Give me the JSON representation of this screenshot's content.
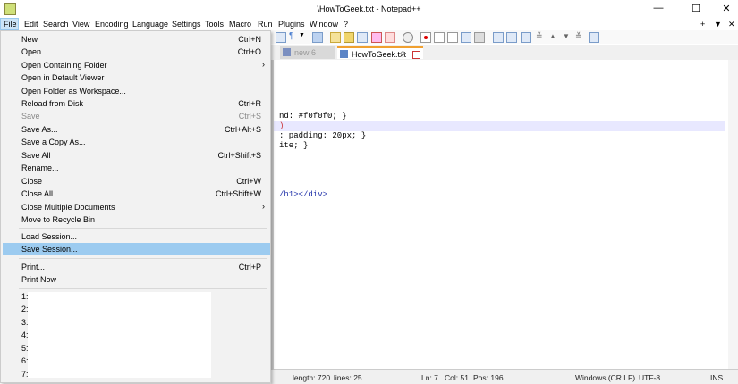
{
  "window": {
    "title": "\\HowToGeek.txt - Notepad++",
    "controls": [
      "—",
      "☐",
      "✕"
    ]
  },
  "menubar": [
    "File",
    "Edit",
    "Search",
    "View",
    "Encoding",
    "Language",
    "Settings",
    "Tools",
    "Macro",
    "Run",
    "Plugins",
    "Window",
    "?"
  ],
  "menubar_right": [
    "+",
    "▼",
    "✕"
  ],
  "tabs": [
    {
      "label": "new 6",
      "active": false
    },
    {
      "label": "HowToGeek.txt",
      "active": true
    }
  ],
  "editor": {
    "lines": [
      {
        "text": "nd: #f0f0f0; }"
      },
      {
        "text": ")"
      },
      {
        "text": ": padding: 20px; }"
      },
      {
        "text": "ite; }"
      },
      {
        "text": "/h1></div>"
      }
    ]
  },
  "status": {
    "length": "length: 720",
    "lines": "lines: 25",
    "ln": "Ln: 7",
    "col": "Col: 51",
    "pos": "Pos: 196",
    "eol": "Windows (CR LF)",
    "encoding": "UTF-8",
    "mode": "INS"
  },
  "file_menu": {
    "items": [
      {
        "label": "New",
        "shortcut": "Ctrl+N"
      },
      {
        "label": "Open...",
        "shortcut": "Ctrl+O"
      },
      {
        "label": "Open Containing Folder",
        "submenu": "›"
      },
      {
        "label": "Open in Default Viewer"
      },
      {
        "label": "Open Folder as Workspace..."
      },
      {
        "label": "Reload from Disk",
        "shortcut": "Ctrl+R"
      },
      {
        "label": "Save",
        "shortcut": "Ctrl+S",
        "disabled": true
      },
      {
        "label": "Save As...",
        "shortcut": "Ctrl+Alt+S"
      },
      {
        "label": "Save a Copy As..."
      },
      {
        "label": "Save All",
        "shortcut": "Ctrl+Shift+S"
      },
      {
        "label": "Rename..."
      },
      {
        "label": "Close",
        "shortcut": "Ctrl+W"
      },
      {
        "label": "Close All",
        "shortcut": "Ctrl+Shift+W"
      },
      {
        "label": "Close Multiple Documents",
        "submenu": "›"
      },
      {
        "label": "Move to Recycle Bin"
      },
      {
        "label": "Load Session..."
      },
      {
        "label": "Save Session...",
        "highlighted": true
      },
      {
        "label": "Print...",
        "shortcut": "Ctrl+P"
      },
      {
        "label": "Print Now"
      }
    ],
    "recent": [
      "1:",
      "2:",
      "3:",
      "4:",
      "5:",
      "6:",
      "7:"
    ]
  }
}
